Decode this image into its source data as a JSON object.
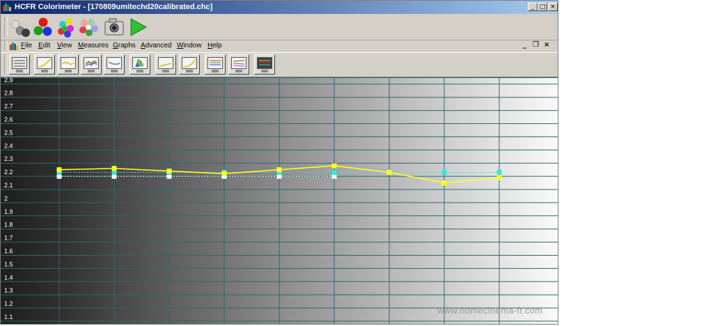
{
  "window": {
    "title": "HCFR Colorimeter - [170809umitechd20calibrated.chc]",
    "buttons": {
      "minimize": "_",
      "maximize": "□",
      "close": "×"
    }
  },
  "menu": {
    "items": [
      {
        "first": "F",
        "rest": "ile"
      },
      {
        "first": "E",
        "rest": "dit"
      },
      {
        "first": "V",
        "rest": "iew"
      },
      {
        "first": "M",
        "rest": "easures"
      },
      {
        "first": "G",
        "rest": "raphs"
      },
      {
        "first": "A",
        "rest": "dvanced"
      },
      {
        "first": "W",
        "rest": "indow"
      },
      {
        "first": "H",
        "rest": "elp"
      }
    ],
    "mdi": {
      "minimize": "_",
      "restore": "❐",
      "close": "×"
    }
  },
  "toolbar1": {
    "icons": [
      "grayscale-spheres-icon",
      "rgb-spheres-icon",
      "color-spheres-icon",
      "saturation-spheres-icon",
      "camera-icon",
      "play-icon"
    ]
  },
  "toolbar2": {
    "icons": [
      "measures-view-icon",
      "gamma-view-icon",
      "luminance-view-icon",
      "rgb-levels-view-icon",
      "color-temp-view-icon",
      "cie-chart-view-icon",
      "delta-e-view-icon",
      "near-black-view-icon",
      "near-white-view-icon",
      "saturation-luminance-view-icon",
      "saturation-shift-view-icon",
      "measurements-grid-view-icon"
    ]
  },
  "chart_data": {
    "type": "line",
    "x": [
      10,
      20,
      30,
      40,
      50,
      60,
      70,
      80,
      90
    ],
    "ylim": [
      1.1,
      3.0
    ],
    "yticks": [
      "2.9",
      "2.8",
      "2.7",
      "2.6",
      "2.5",
      "2.4",
      "2.3",
      "2.2",
      "2.1",
      "2",
      "1.9",
      "1.8",
      "1.7",
      "1.6",
      "1.5",
      "1.4",
      "1.3",
      "1.2",
      "1.1"
    ],
    "grid": true,
    "series": [
      {
        "values": [
          2.25,
          2.26,
          2.24,
          2.22,
          2.25,
          2.28,
          2.23,
          2.15,
          2.19
        ],
        "color": "#ffff22"
      },
      {
        "values": [
          2.23,
          2.23,
          2.23,
          2.23,
          2.23,
          2.23,
          2.23,
          2.23,
          2.23
        ],
        "color": "#33e6e6"
      },
      {
        "values": [
          2.2,
          2.2,
          2.2,
          2.2,
          2.2,
          2.2
        ],
        "color": "#ffffff"
      }
    ]
  },
  "watermark": "www.homecinema-fr.com"
}
